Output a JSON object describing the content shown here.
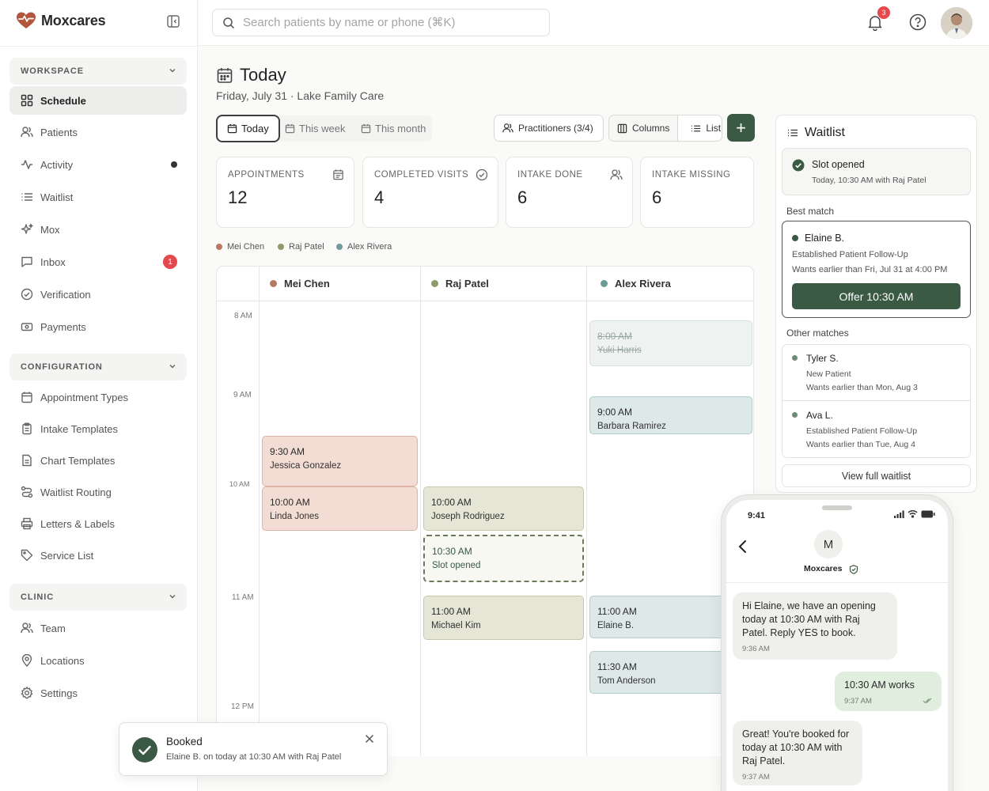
{
  "brand": {
    "name": "Moxcares"
  },
  "search": {
    "placeholder": "Search patients by name or phone (⌘K)"
  },
  "notifications": {
    "count": "3"
  },
  "sidebar": {
    "workspace_label": "WORKSPACE",
    "workspace": [
      {
        "label": "Schedule",
        "icon": "grid-icon",
        "active": true
      },
      {
        "label": "Patients",
        "icon": "users-icon"
      },
      {
        "label": "Activity",
        "icon": "activity-icon"
      },
      {
        "label": "Waitlist",
        "icon": "list-icon"
      },
      {
        "label": "Mox",
        "icon": "sparkle-icon"
      },
      {
        "label": "Inbox",
        "icon": "message-icon",
        "badge": "1"
      },
      {
        "label": "Verification",
        "icon": "check-circle-icon"
      },
      {
        "label": "Payments",
        "icon": "payment-icon"
      }
    ],
    "configuration_label": "CONFIGURATION",
    "configuration": [
      {
        "label": "Appointment Types",
        "icon": "calendar-icon"
      },
      {
        "label": "Intake Templates",
        "icon": "clipboard-icon"
      },
      {
        "label": "Chart Templates",
        "icon": "document-icon"
      },
      {
        "label": "Waitlist Routing",
        "icon": "routing-icon"
      },
      {
        "label": "Letters & Labels",
        "icon": "printer-icon"
      },
      {
        "label": "Service List",
        "icon": "tag-icon"
      }
    ],
    "clinic_label": "CLINIC",
    "clinic": [
      {
        "label": "Team",
        "icon": "users-icon"
      },
      {
        "label": "Locations",
        "icon": "pin-icon"
      },
      {
        "label": "Settings",
        "icon": "gear-icon"
      }
    ]
  },
  "header": {
    "title": "Today",
    "subtitle": "Friday, July 31 · Lake Family Care"
  },
  "range_tabs": [
    {
      "label": "Today",
      "selected": true
    },
    {
      "label": "This week"
    },
    {
      "label": "This month"
    }
  ],
  "toolbar": {
    "practitioners": "Practitioners (3/4)",
    "columns": "Columns",
    "list": "List",
    "add": "+"
  },
  "stats": [
    {
      "label": "APPOINTMENTS",
      "value": "12",
      "icon": "calendar-icon"
    },
    {
      "label": "COMPLETED VISITS",
      "value": "4",
      "icon": "check-circle-icon"
    },
    {
      "label": "INTAKE DONE",
      "value": "6",
      "icon": "users-icon"
    },
    {
      "label": "INTAKE MISSING",
      "value": "6",
      "icon": ""
    }
  ],
  "practitioners": [
    {
      "name": "Mei Chen",
      "color": "#b67a5f"
    },
    {
      "name": "Raj Patel",
      "color": "#8d9a6a"
    },
    {
      "name": "Alex Rivera",
      "color": "#6f9c96"
    }
  ],
  "hours": [
    "8 AM",
    "9 AM",
    "10 AM",
    "11 AM",
    "12 PM"
  ],
  "events": {
    "mei": [
      {
        "time": "9:30 AM",
        "name": "Jessica Gonzalez"
      },
      {
        "time": "10:00 AM",
        "name": "Linda Jones"
      }
    ],
    "raj": [
      {
        "time": "10:00 AM",
        "name": "Joseph Rodriguez"
      },
      {
        "time": "10:30 AM",
        "name": "Slot opened"
      },
      {
        "time": "11:00 AM",
        "name": "Michael Kim"
      }
    ],
    "alex": [
      {
        "time": "8:00 AM",
        "name": "Yuki Harris"
      },
      {
        "time": "9:00 AM",
        "name": "Barbara Ramirez"
      },
      {
        "time": "11:00 AM",
        "name": "Elaine B."
      },
      {
        "time": "11:30 AM",
        "name": "Tom Anderson"
      }
    ]
  },
  "waitlist": {
    "title": "Waitlist",
    "slot": {
      "title": "Slot opened",
      "detail": "Today, 10:30 AM with Raj Patel"
    },
    "best_match_label": "Best match",
    "best": {
      "name": "Elaine B.",
      "type": "Established Patient Follow-Up",
      "wants": "Wants earlier than Fri, Jul 31 at 4:00 PM",
      "offer": "Offer 10:30 AM"
    },
    "other_label": "Other matches",
    "others": [
      {
        "name": "Tyler S.",
        "type": "New Patient",
        "wants": "Wants earlier than Mon, Aug 3"
      },
      {
        "name": "Ava L.",
        "type": "Established Patient Follow-Up",
        "wants": "Wants earlier than Tue, Aug 4"
      }
    ],
    "view_all": "View full waitlist"
  },
  "phone": {
    "time": "9:41",
    "contact_initial": "M",
    "contact_name": "Moxcares",
    "messages": [
      {
        "text": "Hi Elaine, we have an opening today at 10:30 AM with Raj Patel. Reply YES to book.",
        "time": "9:36 AM"
      },
      {
        "text": "10:30 AM works",
        "time": "9:37 AM"
      },
      {
        "text": "Great! You're booked for today at 10:30 AM with Raj Patel.",
        "time": "9:37 AM"
      }
    ]
  },
  "toast": {
    "title": "Booked",
    "detail": "Elaine B. on today at 10:30 AM with Raj Patel"
  },
  "colors": {
    "accent": "#3b5a44",
    "danger": "#e5484d"
  }
}
